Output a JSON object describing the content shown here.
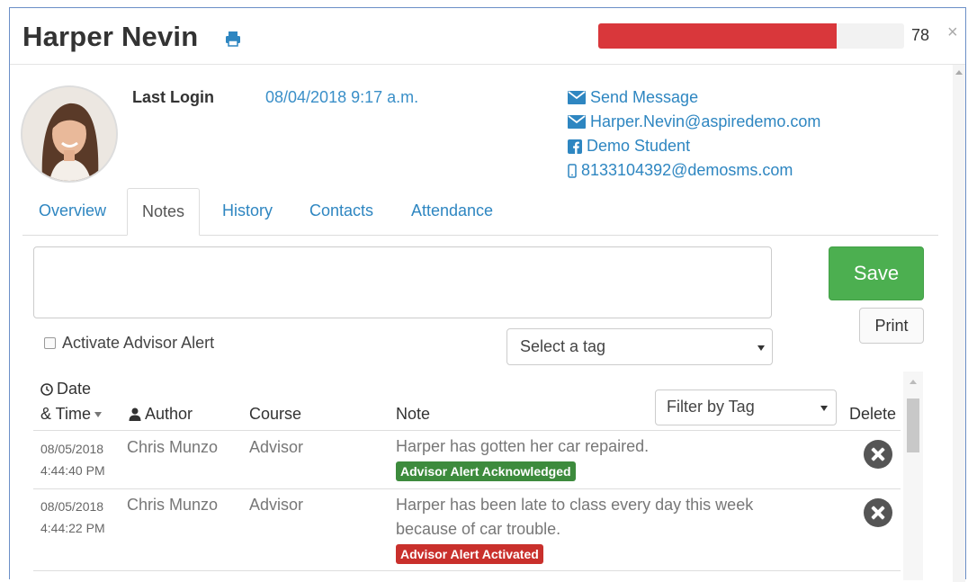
{
  "header": {
    "student_name": "Harper Nevin",
    "progress_value": "78",
    "progress_fraction": 0.78,
    "progress_color": "#d9373b",
    "close_glyph": "×"
  },
  "profile": {
    "last_login_label": "Last Login",
    "last_login_value": "08/04/2018 9:17 a.m.",
    "contacts": [
      {
        "icon": "envelope-icon",
        "text": "Send Message"
      },
      {
        "icon": "envelope-icon",
        "text": "Harper.Nevin@aspiredemo.com"
      },
      {
        "icon": "facebook-icon",
        "text": "Demo Student"
      },
      {
        "icon": "mobile-icon",
        "text": "8133104392@demosms.com"
      }
    ]
  },
  "tabs": [
    {
      "label": "Overview",
      "active": false
    },
    {
      "label": "Notes",
      "active": true
    },
    {
      "label": "History",
      "active": false
    },
    {
      "label": "Contacts",
      "active": false
    },
    {
      "label": "Attendance",
      "active": false
    }
  ],
  "note_form": {
    "note_value": "",
    "save_label": "Save",
    "print_label": "Print",
    "alert_label": "Activate Advisor Alert",
    "alert_checked": false,
    "tag_placeholder": "Select a tag"
  },
  "table": {
    "headers": {
      "date_line1": "Date",
      "date_line2": "& Time",
      "author": "Author",
      "course": "Course",
      "note": "Note",
      "delete": "Delete"
    },
    "filter_placeholder": "Filter by Tag",
    "rows": [
      {
        "date": "08/05/2018",
        "time": "4:44:40 PM",
        "author": "Chris Munzo",
        "course": "Advisor",
        "note": "Harper has gotten her car repaired.",
        "badge": "Advisor Alert Acknowledged",
        "badge_color": "#3d8b3d"
      },
      {
        "date": "08/05/2018",
        "time": "4:44:22 PM",
        "author": "Chris Munzo",
        "course": "Advisor",
        "note": "Harper has been late to class every day this week because of car trouble.",
        "badge": "Advisor Alert Activated",
        "badge_color": "#c9302c"
      }
    ]
  }
}
